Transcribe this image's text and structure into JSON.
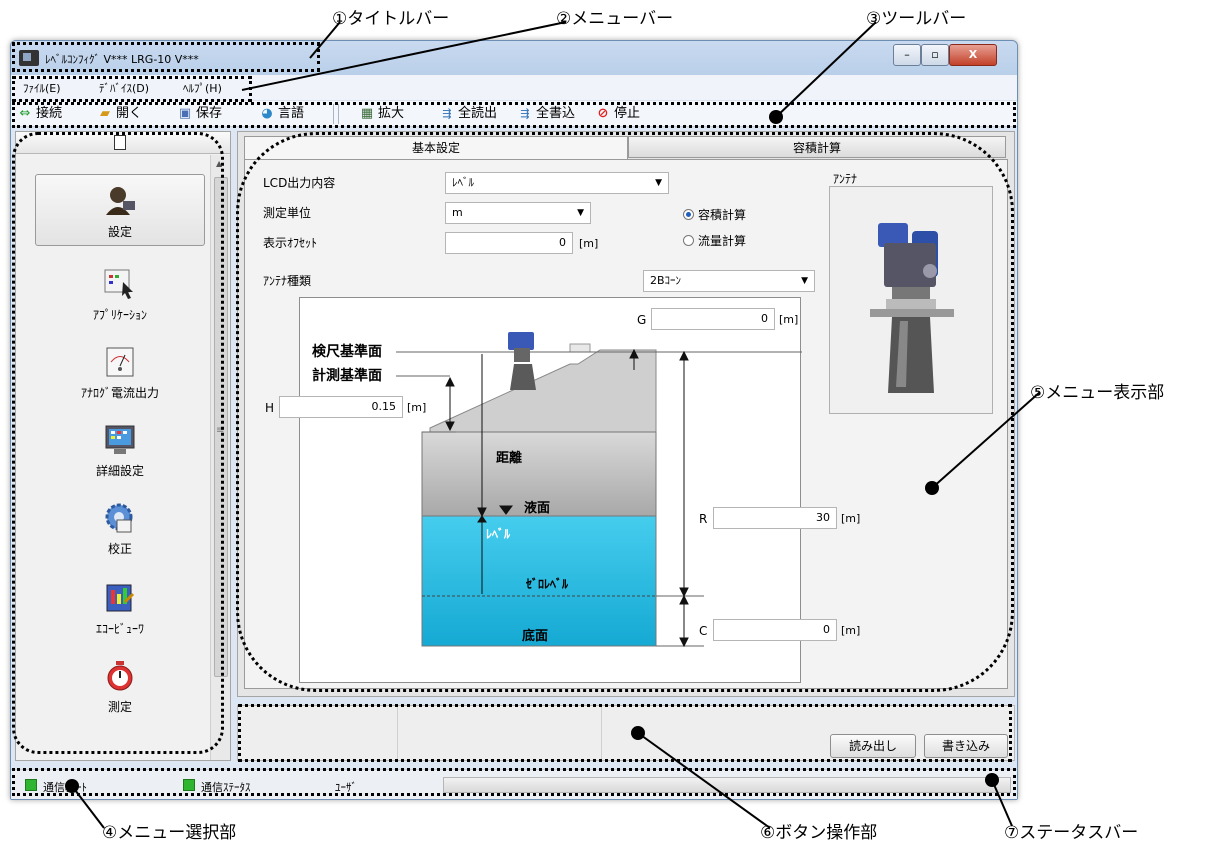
{
  "window": {
    "title": "ﾚﾍﾞﾙｺﾝﾌｨｸﾞ V***  LRG-10 V***",
    "minimize": "–",
    "maximize": "▫",
    "close": "X"
  },
  "menu": [
    "ﾌｧｲﾙ(E)",
    "ﾃﾞﾊﾞｲｽ(D)",
    "ﾍﾙﾌﾟ(H)"
  ],
  "toolbar": {
    "connect": "接続",
    "open": "開く",
    "save": "保存",
    "language": "言語",
    "zoom": "拡大",
    "read_all": "全読出",
    "write_all": "全書込",
    "stop": "停止"
  },
  "nav": [
    "設定",
    "ｱﾌﾟﾘｹｰｼｮﾝ",
    "ｱﾅﾛｸﾞ電流出力",
    "詳細設定",
    "校正",
    "ｴｺｰﾋﾞｭｰﾜ",
    "測定"
  ],
  "tabs": [
    "基本設定",
    "容積計算"
  ],
  "form": {
    "lcd_label": "LCD出力内容",
    "lcd_value": "ﾚﾍﾞﾙ",
    "unit_label": "測定単位",
    "unit_value": "m",
    "offset_label": "表示ｵﾌｾｯﾄ",
    "offset_value": "0",
    "antenna_type_label": "ｱﾝﾃﾅ種類",
    "antenna_type_value": "2Bｺｰﾝ",
    "antenna_box_label": "ｱﾝﾃﾅ",
    "unit_suffix": "[m]",
    "radio_volume": "容積計算",
    "radio_flow": "流量計算"
  },
  "diagram": {
    "g_label": "G",
    "g_value": "0",
    "h_label": "H",
    "h_value": "0.15",
    "r_label": "R",
    "r_value": "30",
    "c_label": "C",
    "c_value": "0",
    "ref_dipstick": "検尺基準面",
    "ref_measure": "計測基準面",
    "distance": "距離",
    "liquid_surface": "液面",
    "level": "ﾚﾍﾞﾙ",
    "zero_level": "ｾﾞﾛﾚﾍﾞﾙ",
    "bottom": "底面"
  },
  "buttons": {
    "read": "読み出し",
    "write": "書き込み"
  },
  "status": {
    "port": "通信ﾎﾟｰﾄ",
    "comm": "通信ｽﾃｰﾀｽ",
    "user": "ﾕｰｻﾞ"
  },
  "callouts": {
    "c1": "①タイトルバー",
    "c2": "②メニューバー",
    "c3": "③ツールバー",
    "c4": "④メニュー選択部",
    "c5": "⑤メニュー表示部",
    "c6": "⑥ボタン操作部",
    "c7": "⑦ステータスバー"
  },
  "colors": {
    "liquid": "#23b8e0",
    "status_ok": "#2fb52f",
    "stop": "#e02020"
  }
}
